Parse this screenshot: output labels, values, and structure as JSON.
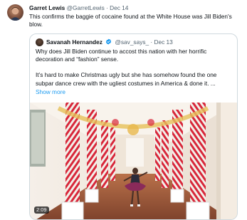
{
  "tweet": {
    "author_name": "Garret Lewis",
    "author_handle": "@GarretLewis",
    "separator": "·",
    "date": "Dec 14",
    "text": "This confirms the baggie of cocaine found at the White House was Jill Biden's blow."
  },
  "quoted": {
    "author_name": "Savanah Hernandez",
    "author_handle": "@sav_says_",
    "separator": "·",
    "date": "Dec 13",
    "paragraph1": "Why does Jill Biden continue to accost this nation with her horrific decoration and “fashion” sense.",
    "paragraph2": "It’s hard to make Christmas ugly but she has somehow found the one subpar dance crew with the ugliest costumes in America & done it. ...",
    "show_more": "Show more",
    "video_duration": "2:09",
    "verified_color": "#1d9bf0"
  }
}
